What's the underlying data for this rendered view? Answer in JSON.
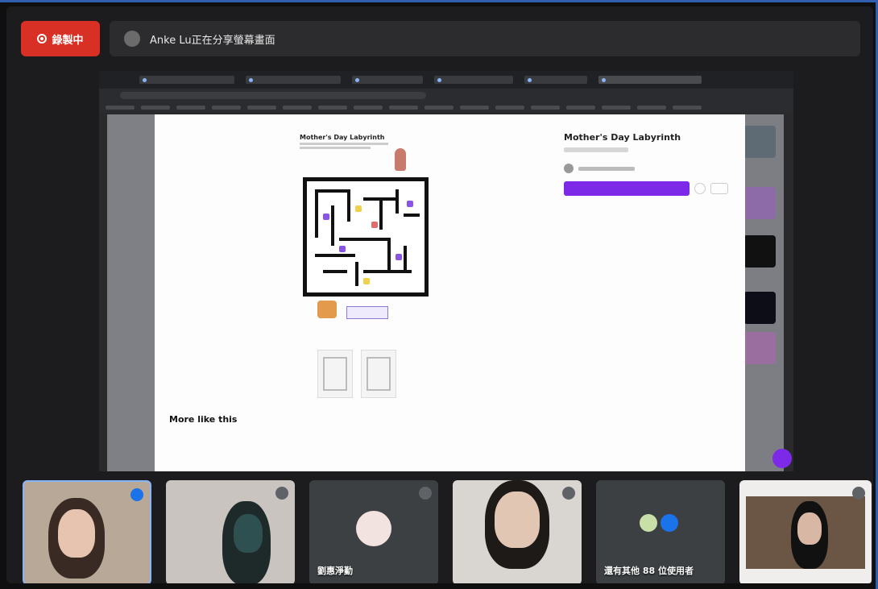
{
  "recording": {
    "label": "錄製中"
  },
  "presenting": {
    "text": "Anke Lu正在分享螢幕畫面"
  },
  "shared_page": {
    "maze_title": "Mother's Day Labyrinth",
    "more_heading": "More like this"
  },
  "design_panel": {
    "title": "Mother's Day Labyrinth"
  },
  "participants": [
    {
      "name": "",
      "mic": "on"
    },
    {
      "name": "",
      "mic": "off"
    },
    {
      "name": "劉惠淨勤",
      "mic": "off"
    },
    {
      "name": "",
      "mic": "off"
    },
    {
      "name": "還有其他 88 位使用者",
      "mic": "on"
    },
    {
      "name": "",
      "mic": "off"
    }
  ],
  "colors": {
    "record_red": "#d93025",
    "canva_purple": "#7d2ae8",
    "active_tile_border": "#8ab4f8"
  }
}
